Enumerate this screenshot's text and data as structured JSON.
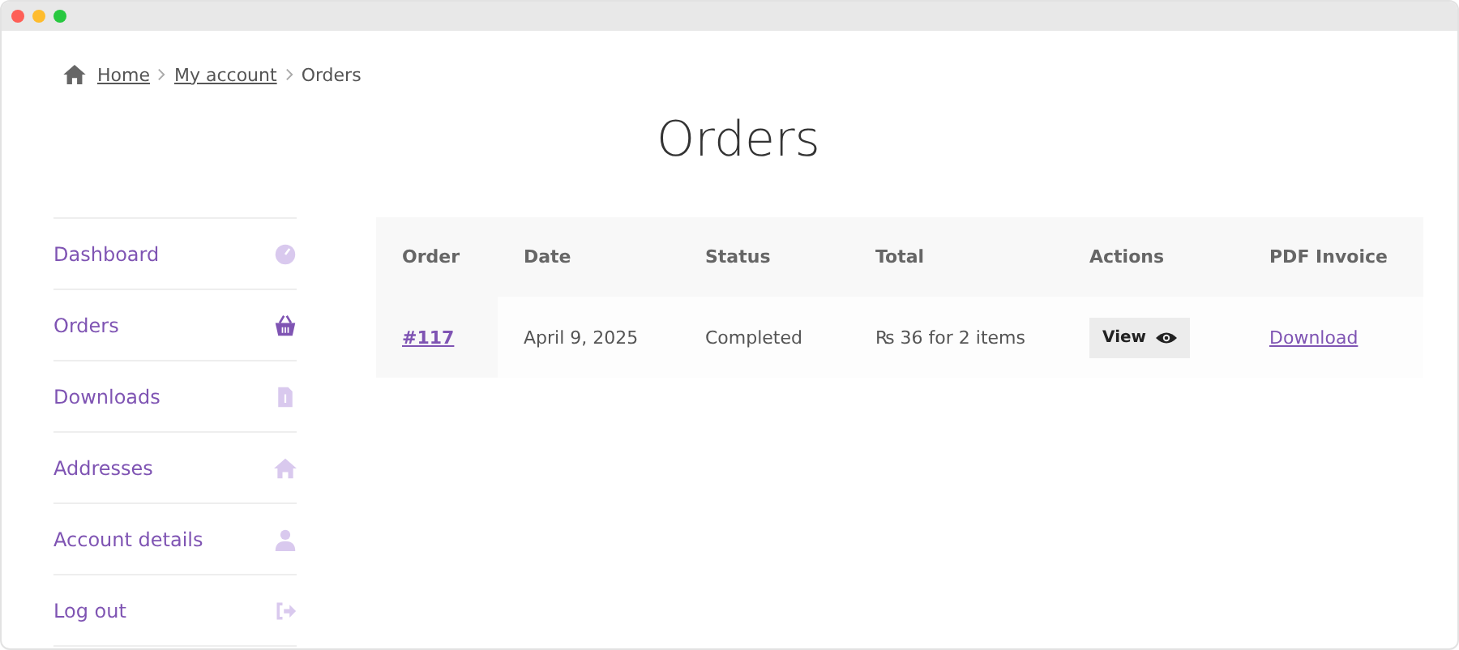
{
  "breadcrumb": [
    {
      "label": "Home",
      "link": true
    },
    {
      "label": "My account",
      "link": true
    },
    {
      "label": "Orders",
      "link": false
    }
  ],
  "page_title": "Orders",
  "sidebar": {
    "items": [
      {
        "label": "Dashboard",
        "kind": "dashboard",
        "selected": false
      },
      {
        "label": "Orders",
        "kind": "basket",
        "selected": true
      },
      {
        "label": "Downloads",
        "kind": "file",
        "selected": false
      },
      {
        "label": "Addresses",
        "kind": "home",
        "selected": false
      },
      {
        "label": "Account details",
        "kind": "user",
        "selected": false
      },
      {
        "label": "Log out",
        "kind": "logout",
        "selected": false
      }
    ]
  },
  "table": {
    "columns": [
      "Order",
      "Date",
      "Status",
      "Total",
      "Actions",
      "PDF Invoice"
    ],
    "rows": [
      {
        "order": "#117",
        "date": "April 9, 2025",
        "status": "Completed",
        "total": "₨ 36 for 2 items",
        "action": "View",
        "invoice": "Download"
      }
    ]
  }
}
